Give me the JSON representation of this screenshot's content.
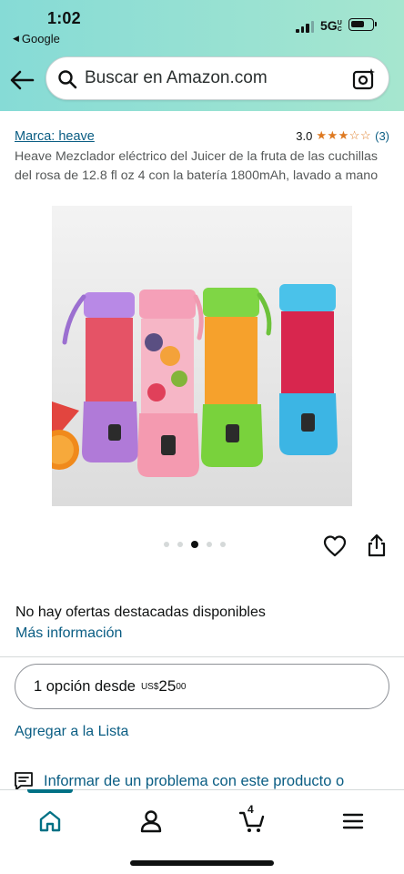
{
  "status_bar": {
    "time": "1:02",
    "back_app": "Google",
    "network": "5G",
    "network_suffix": "UC"
  },
  "search": {
    "placeholder": "Buscar en Amazon.com"
  },
  "product": {
    "brand": "Marca: heave",
    "rating": "3.0",
    "stars": "★★★☆☆",
    "rating_count": "(3)",
    "title": "Heave Mezclador eléctrico del Juicer de la fruta de las cuchillas del rosa de 12.8 fl oz 4 con la batería 1800mAh, lavado a mano",
    "image_index": 3,
    "image_count": 5
  },
  "offers": {
    "no_offers": "No hay ofertas destacadas disponibles",
    "more_info": "Más información",
    "option_prefix": "1 opción desde",
    "currency": "US$",
    "price_whole": "25",
    "price_cents": "00",
    "add_list": "Agregar a la Lista",
    "report": "Informar de un problema con este producto o"
  },
  "tabbar": {
    "cart_count": "4"
  },
  "colors": {
    "header_gradient_start": "#86dbd6",
    "header_gradient_end": "#a6e6cf",
    "link": "#0a5d83",
    "star": "#de7921",
    "active_tab": "#007185"
  }
}
